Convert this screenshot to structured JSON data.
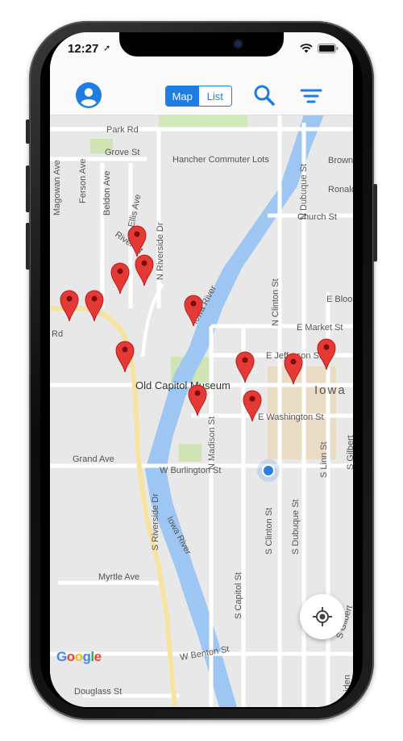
{
  "status_bar": {
    "time": "12:27"
  },
  "header": {
    "view_toggle": {
      "options": [
        "Map",
        "List"
      ],
      "selected": "Map"
    },
    "accent_color": "#1f7ce0"
  },
  "map": {
    "landmarks": {
      "hancher": "Hancher Commuter Lots",
      "museum": "Old Capitol Museum",
      "iowa": "Iowa"
    },
    "roads": {
      "park_rd": "Park Rd",
      "grove_st": "Grove St",
      "magowan_ave": "Magowan Ave",
      "ferson_ave": "Ferson Ave",
      "beldon_ave": "Beldon Ave",
      "ellis_ave": "Ellis Ave",
      "river_st": "River St",
      "n_riverside_dr": "N Riverside Dr",
      "iowa_river_n": "Iowa River",
      "iowa_river_s": "Iowa River",
      "n_dubuque_st": "N Dubuque St",
      "brown": "Brown",
      "ronalds": "Ronalds",
      "church_st": "Church St",
      "n_clinton_st": "N Clinton St",
      "e_bloomington": "E Bloo",
      "e_market_st": "E Market St",
      "rd": "Rd",
      "e_jefferson_st": "E Jefferson St",
      "e_washington_st": "E Washington St",
      "n_madison_st": "N Madison St",
      "s_gilbert_st_top": "S Gilbert",
      "s_linn_st": "S Linn St",
      "grand_ave": "Grand Ave",
      "w_burlington_st": "W Burlington St",
      "s_clinton_st": "S Clinton St",
      "s_dubuque_st": "S Dubuque St",
      "s_riverside_dr": "S Riverside Dr",
      "myrtle_ave": "Myrtle Ave",
      "s_capitol_st": "S Capitol St",
      "s_gilbert_st": "S Gilbert",
      "w_benton_st": "W Benton St",
      "douglass_st": "Douglass St",
      "maiden": "Maiden"
    },
    "pin_color": "#e53935",
    "pins": [
      {
        "id": "pin-river-st"
      },
      {
        "id": "pin-ellis-west"
      },
      {
        "id": "pin-riverside-dr"
      },
      {
        "id": "pin-west-1"
      },
      {
        "id": "pin-west-2"
      },
      {
        "id": "pin-iowa-river-east"
      },
      {
        "id": "pin-old-capitol-west"
      },
      {
        "id": "pin-capitol-south"
      },
      {
        "id": "pin-capitol-east-1"
      },
      {
        "id": "pin-capitol-east-2"
      },
      {
        "id": "pin-pentacrest"
      },
      {
        "id": "pin-iowa-east"
      }
    ],
    "attribution": "Google"
  }
}
